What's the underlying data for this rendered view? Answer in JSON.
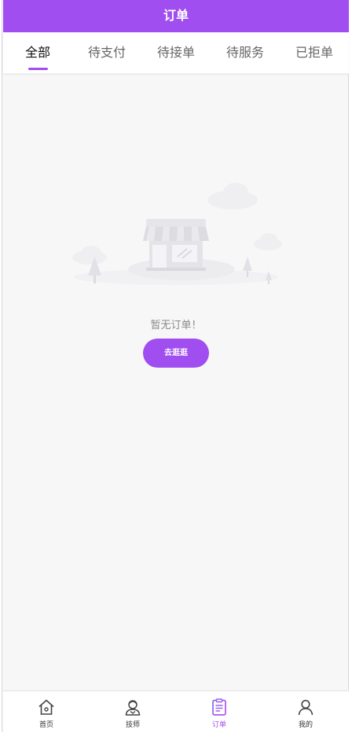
{
  "header": {
    "title": "订单"
  },
  "tabs": [
    {
      "label": "全部",
      "active": true
    },
    {
      "label": "待支付",
      "active": false
    },
    {
      "label": "待接单",
      "active": false
    },
    {
      "label": "待服务",
      "active": false
    },
    {
      "label": "已拒单",
      "active": false
    }
  ],
  "empty": {
    "message": "暂无订单！",
    "button_label": "去逛逛",
    "illustration_icon": "empty-shop-icon"
  },
  "tabbar": [
    {
      "label": "首页",
      "icon": "home-icon",
      "active": false
    },
    {
      "label": "技师",
      "icon": "technician-icon",
      "active": false
    },
    {
      "label": "订单",
      "icon": "order-clipboard-icon",
      "active": true
    },
    {
      "label": "我的",
      "icon": "user-icon",
      "active": false
    }
  ],
  "colors": {
    "accent": "#a04ef0",
    "background": "#f7f7f8"
  }
}
